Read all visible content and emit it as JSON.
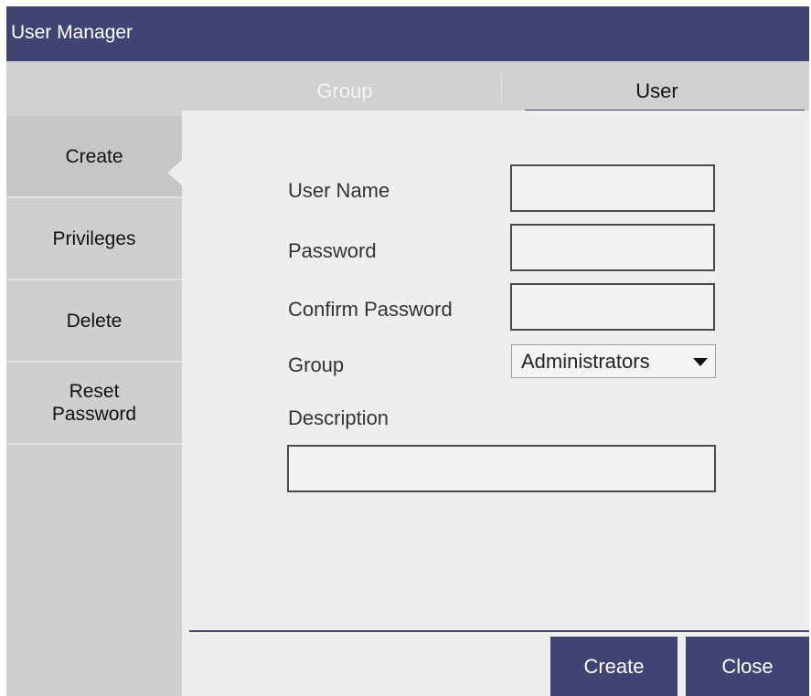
{
  "window": {
    "title": "User Manager"
  },
  "tabs": [
    {
      "label": "Group",
      "selected": false
    },
    {
      "label": "User",
      "selected": true
    }
  ],
  "sidebar": {
    "items": [
      {
        "label": "Create",
        "active": true
      },
      {
        "label": "Privileges",
        "active": false
      },
      {
        "label": "Delete",
        "active": false
      },
      {
        "label_lines": [
          "Reset",
          "Password"
        ],
        "active": false
      }
    ]
  },
  "form": {
    "user_name": {
      "label": "User Name",
      "value": ""
    },
    "password": {
      "label": "Password",
      "value": ""
    },
    "confirm_password": {
      "label": "Confirm Password",
      "value": ""
    },
    "group": {
      "label": "Group",
      "selected": "Administrators"
    },
    "description": {
      "label": "Description",
      "value": ""
    }
  },
  "footer": {
    "create_label": "Create",
    "close_label": "Close"
  },
  "colors": {
    "accent": "#3f4473",
    "tab_bar": "#d0d0d0",
    "sidebar": "#cfcfcf",
    "content": "#eeeeee"
  },
  "icons": {
    "dropdown": "caret-down-icon"
  }
}
